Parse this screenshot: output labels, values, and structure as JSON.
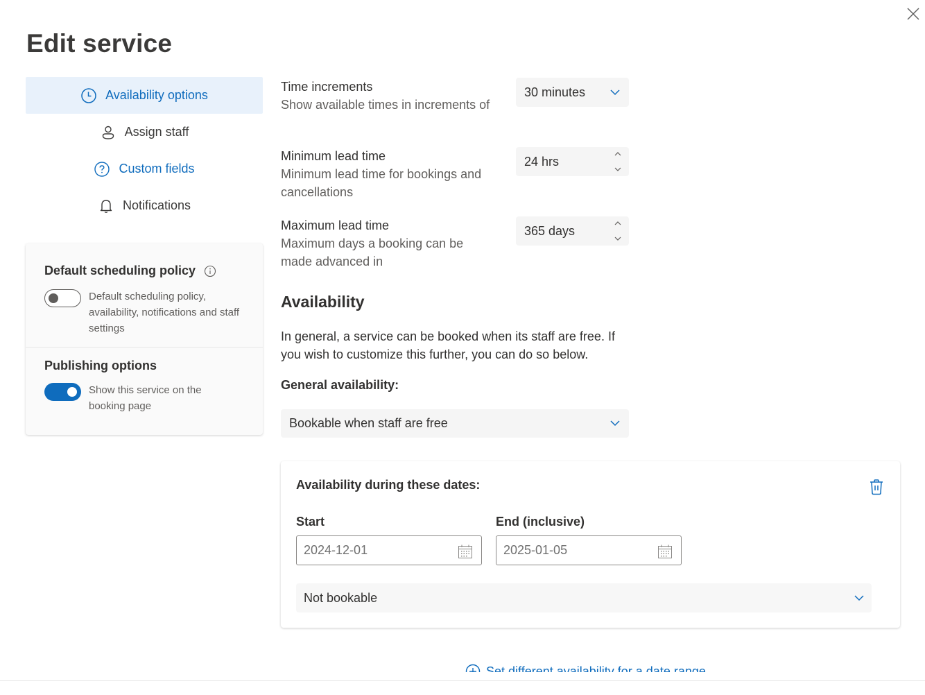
{
  "dialog": {
    "title": "Edit service",
    "close_label": "Close"
  },
  "nav": {
    "items": [
      {
        "label": "Availability options",
        "icon": "clock-icon",
        "active": true
      },
      {
        "label": "Assign staff",
        "icon": "person-icon",
        "active": false
      },
      {
        "label": "Custom fields",
        "icon": "question-circle-icon",
        "active": false
      },
      {
        "label": "Notifications",
        "icon": "bell-icon",
        "active": false
      }
    ]
  },
  "settings": {
    "default_policy": {
      "title": "Default scheduling policy",
      "info_icon": "info-icon",
      "toggle_on": false,
      "toggle_label": "Default scheduling policy, availability, notifications and staff settings"
    },
    "publishing": {
      "title": "Publishing options",
      "toggle_on": true,
      "toggle_label": "Show this service on the booking page"
    }
  },
  "form": {
    "time_increments": {
      "label": "Time increments",
      "desc": "Show available times in increments of",
      "value": "30 minutes"
    },
    "min_lead": {
      "label": "Minimum lead time",
      "desc": "Minimum lead time for bookings and cancellations",
      "value": "24 hrs"
    },
    "max_lead": {
      "label": "Maximum lead time",
      "desc": "Maximum days a booking can be made advanced in",
      "value": "365 days"
    }
  },
  "availability": {
    "title": "Availability",
    "desc": "In general, a service can be booked when its staff are free. If you wish to customize this further, you can do so below.",
    "general_label": "General availability:",
    "general_value": "Bookable when staff are free",
    "range": {
      "title": "Availability during these dates:",
      "start_label": "Start",
      "start_value": "2024-12-01",
      "end_label": "End (inclusive)",
      "end_value": "2025-01-05",
      "bookable_value": "Not bookable"
    },
    "add_range_label": "Set different availability for a date range"
  },
  "colors": {
    "accent": "#0f6cbd",
    "active_nav_bg": "#e8f1fb"
  }
}
